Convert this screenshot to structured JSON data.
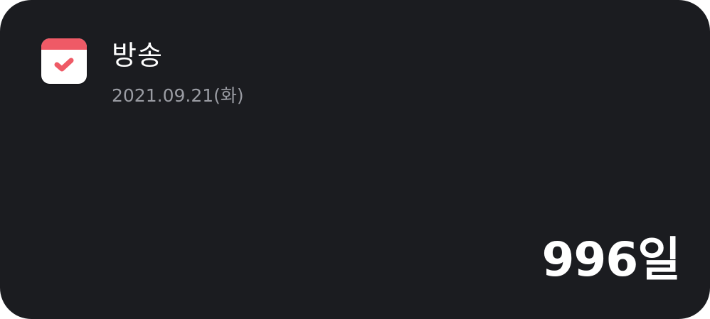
{
  "widget": {
    "app_icon": "calendar-check-icon",
    "title": "방송",
    "date": "2021.09.21(화)",
    "count": "996일"
  },
  "colors": {
    "background": "#1b1c20",
    "accent": "#ef5a66",
    "title_text": "#ffffff",
    "date_text": "#9a9ca3"
  }
}
